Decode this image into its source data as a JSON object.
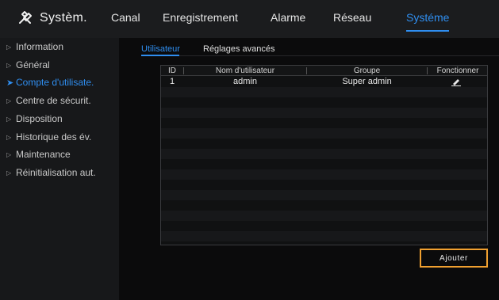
{
  "app": {
    "title": "Systèm."
  },
  "top_nav": {
    "tabs": [
      {
        "label": "Canal",
        "active": false
      },
      {
        "label": "Enregistrement",
        "active": false
      },
      {
        "label": "Alarme",
        "active": false
      },
      {
        "label": "Réseau",
        "active": false
      },
      {
        "label": "Systéme",
        "active": true
      }
    ]
  },
  "sidebar": {
    "items": [
      {
        "label": "Information",
        "active": false
      },
      {
        "label": "Général",
        "active": false
      },
      {
        "label": "Compte d'utilisate.",
        "active": true
      },
      {
        "label": "Centre de sécurit.",
        "active": false
      },
      {
        "label": "Disposition",
        "active": false
      },
      {
        "label": "Historique des év.",
        "active": false
      },
      {
        "label": "Maintenance",
        "active": false
      },
      {
        "label": "Réinitialisation aut.",
        "active": false
      }
    ]
  },
  "sub_tabs": [
    {
      "label": "Utilisateur",
      "active": true
    },
    {
      "label": "Réglages avancés",
      "active": false
    }
  ],
  "user_table": {
    "columns": [
      "ID",
      "Nom d'utilisateur",
      "Groupe",
      "Fonctionner"
    ],
    "rows": [
      {
        "id": "1",
        "username": "admin",
        "group": "Super admin"
      }
    ]
  },
  "actions": {
    "add_label": "Ajouter"
  },
  "colors": {
    "accent": "#2f8ef0",
    "highlight": "#f0a030",
    "background": "#0b0b0c",
    "sidebar": "#17181a",
    "topbar": "#1b1c1e"
  },
  "icons": {
    "brand": "tools-icon",
    "sidebar_item": "caret-right-icon",
    "sidebar_active": "chevron-right-icon",
    "edit": "pencil-icon"
  }
}
